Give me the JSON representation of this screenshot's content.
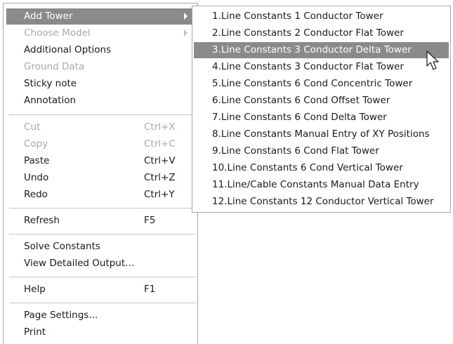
{
  "context_menu": {
    "items": [
      {
        "label": "Add Tower",
        "shortcut": "",
        "disabled": false,
        "highlighted": true,
        "submenu": true
      },
      {
        "label": "Choose Model",
        "shortcut": "",
        "disabled": true,
        "highlighted": false,
        "submenu": true
      },
      {
        "label": "Additional Options",
        "shortcut": "",
        "disabled": false
      },
      {
        "label": "Ground Data",
        "shortcut": "",
        "disabled": true
      },
      {
        "label": "Sticky note",
        "shortcut": "",
        "disabled": false
      },
      {
        "label": "Annotation",
        "shortcut": "",
        "disabled": false
      },
      {
        "label": "Cut",
        "shortcut": "Ctrl+X",
        "disabled": true
      },
      {
        "label": "Copy",
        "shortcut": "Ctrl+C",
        "disabled": true
      },
      {
        "label": "Paste",
        "shortcut": "Ctrl+V",
        "disabled": false
      },
      {
        "label": "Undo",
        "shortcut": "Ctrl+Z",
        "disabled": false
      },
      {
        "label": "Redo",
        "shortcut": "Ctrl+Y",
        "disabled": false
      },
      {
        "label": "Refresh",
        "shortcut": "F5",
        "disabled": false
      },
      {
        "label": "Solve Constants",
        "shortcut": "",
        "disabled": false
      },
      {
        "label": "View Detailed Output...",
        "shortcut": "",
        "disabled": false
      },
      {
        "label": "Help",
        "shortcut": "F1",
        "disabled": false
      },
      {
        "label": "Page Settings...",
        "shortcut": "",
        "disabled": false
      },
      {
        "label": "Print",
        "shortcut": "",
        "disabled": false
      }
    ]
  },
  "submenu": {
    "items": [
      {
        "label": "1.Line Constants 1 Conductor Tower"
      },
      {
        "label": "2.Line Constants 2 Conductor Flat Tower"
      },
      {
        "label": "3.Line Constants 3 Conductor Delta Tower",
        "highlighted": true
      },
      {
        "label": "4.Line Constants 3 Conductor Flat Tower"
      },
      {
        "label": "5.Line Constants 6 Cond Concentric Tower"
      },
      {
        "label": "6.Line Constants 6 Cond Offset Tower"
      },
      {
        "label": "7.Line Constants 6 Cond Delta Tower"
      },
      {
        "label": "8.Line Constants Manual Entry of XY Positions"
      },
      {
        "label": "9.Line Constants 6 Cond Flat Tower"
      },
      {
        "label": "10.Line Constants 6 Cond Vertical Tower"
      },
      {
        "label": "11.Line/Cable Constants Manual Data Entry"
      },
      {
        "label": "12.Line Constants 12 Conductor Vertical Tower"
      }
    ]
  },
  "colors": {
    "highlight": "#8a8a8a",
    "disabled_text": "#a8a8a8",
    "text": "#1a1a1a",
    "border": "#a8a8a8"
  },
  "icons": {
    "submenu_arrow": "chevron-right-icon",
    "pointer": "mouse-cursor-icon"
  }
}
